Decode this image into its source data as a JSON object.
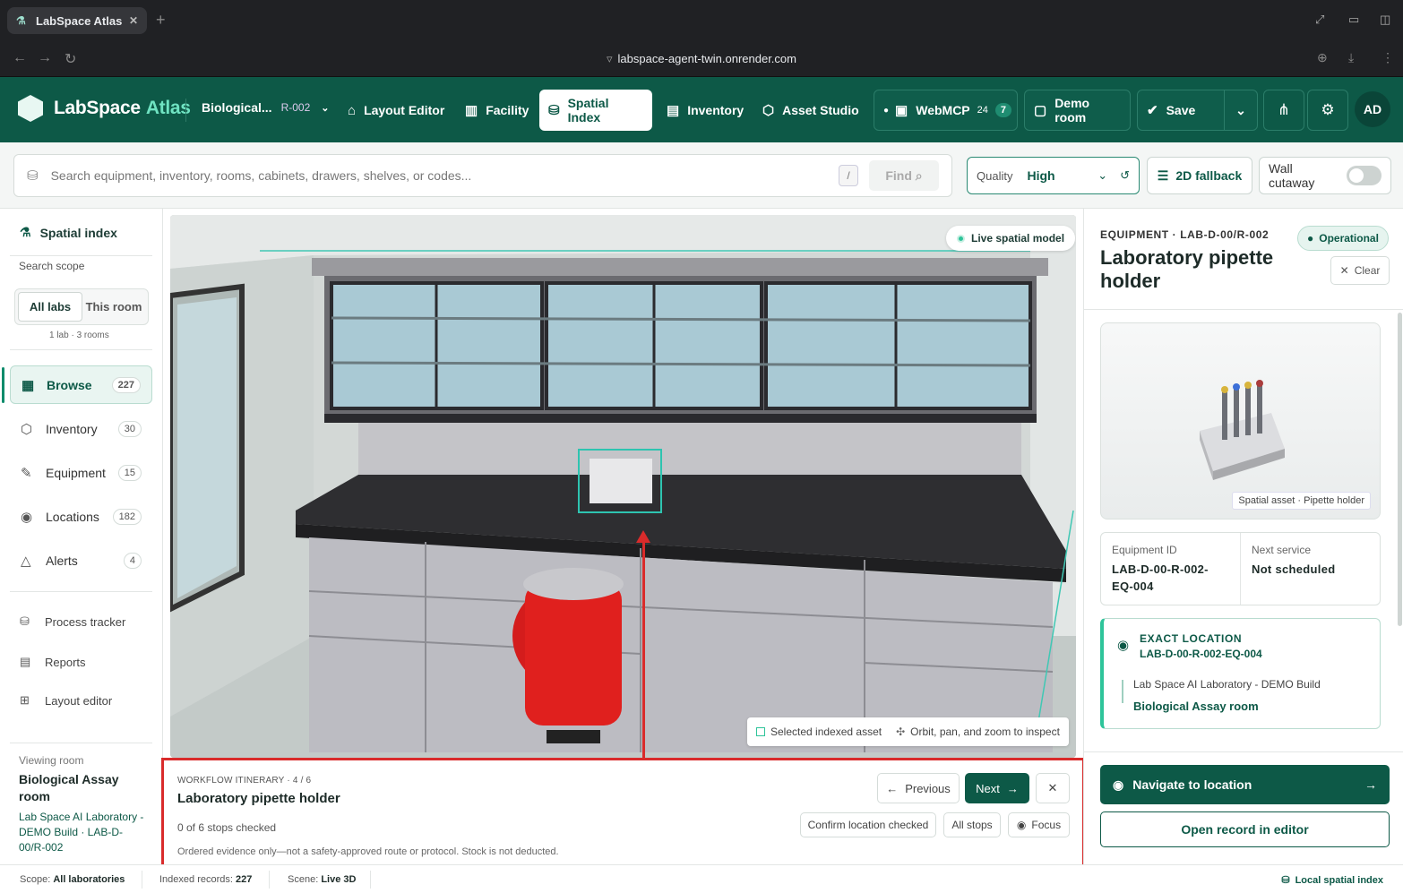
{
  "browser": {
    "tab_title": "LabSpace Atlas",
    "url": "labspace-agent-twin.onrender.com"
  },
  "header": {
    "brand": "LabSpace",
    "brand_accent": "Atlas",
    "room_name": "Biological...",
    "room_code": "R-002",
    "nav": {
      "layout_editor": "Layout Editor",
      "facility": "Facility",
      "spatial_index": "Spatial Index",
      "inventory": "Inventory",
      "asset_studio": "Asset Studio",
      "webmcp": "WebMCP",
      "webmcp_count": "24",
      "webmcp_badge": "7",
      "demo_room": "Demo room",
      "save": "Save"
    },
    "avatar": "AD"
  },
  "search": {
    "placeholder": "Search equipment, inventory, rooms, cabinets, drawers, shelves, or codes...",
    "shortcut": "/",
    "find_label": "Find",
    "quality_label": "Quality",
    "quality_value": "High",
    "fallback_label": "2D fallback",
    "cutaway_label": "Wall cutaway",
    "cutaway_on": false
  },
  "sidebar": {
    "title": "Spatial index",
    "scope_label": "Search scope",
    "scope_options": [
      "All labs",
      "This room"
    ],
    "scope_summary": "1 lab · 3 rooms",
    "items": [
      {
        "label": "Browse",
        "count": "227"
      },
      {
        "label": "Inventory",
        "count": "30"
      },
      {
        "label": "Equipment",
        "count": "15"
      },
      {
        "label": "Locations",
        "count": "182"
      },
      {
        "label": "Alerts",
        "count": "4"
      }
    ],
    "links": [
      "Process tracker",
      "Reports",
      "Layout editor"
    ],
    "viewing_label": "Viewing room",
    "viewing_room": "Biological Assay room",
    "viewing_path": "Lab Space AI Laboratory - DEMO Build · LAB-D-00/R-002"
  },
  "scene": {
    "live_label": "Live spatial model",
    "legend_selected": "Selected indexed asset",
    "legend_hint": "Orbit, pan, and zoom to inspect"
  },
  "itinerary": {
    "step": "WORKFLOW ITINERARY · 4 / 6",
    "title": "Laboratory pipette holder",
    "checked": "0 of 6 stops checked",
    "note": "Ordered evidence only—not a safety-approved route or protocol. Stock is not deducted.",
    "previous": "Previous",
    "next": "Next",
    "confirm": "Confirm location checked",
    "all_stops": "All stops",
    "focus": "Focus"
  },
  "details": {
    "kicker": "EQUIPMENT · LAB-D-00/R-002",
    "status": "Operational",
    "title": "Laboratory pipette holder",
    "clear": "Clear",
    "image_caption": "Spatial asset · Pipette holder",
    "equipment_id_label": "Equipment ID",
    "equipment_id": "LAB-D-00-R-002-EQ-004",
    "next_service_label": "Next service",
    "next_service": "Not scheduled",
    "location_label": "EXACT LOCATION",
    "location_code": "LAB-D-00-R-002-EQ-004",
    "location_lab": "Lab Space AI Laboratory - DEMO Build",
    "location_room": "Biological Assay room",
    "navigate": "Navigate to location",
    "open_record": "Open record in editor"
  },
  "status": {
    "scope_label": "Scope:",
    "scope_value": "All laboratories",
    "indexed_label": "Indexed records:",
    "indexed_value": "227",
    "scene_label": "Scene:",
    "scene_value": "Live 3D",
    "local": "Local spatial index"
  }
}
